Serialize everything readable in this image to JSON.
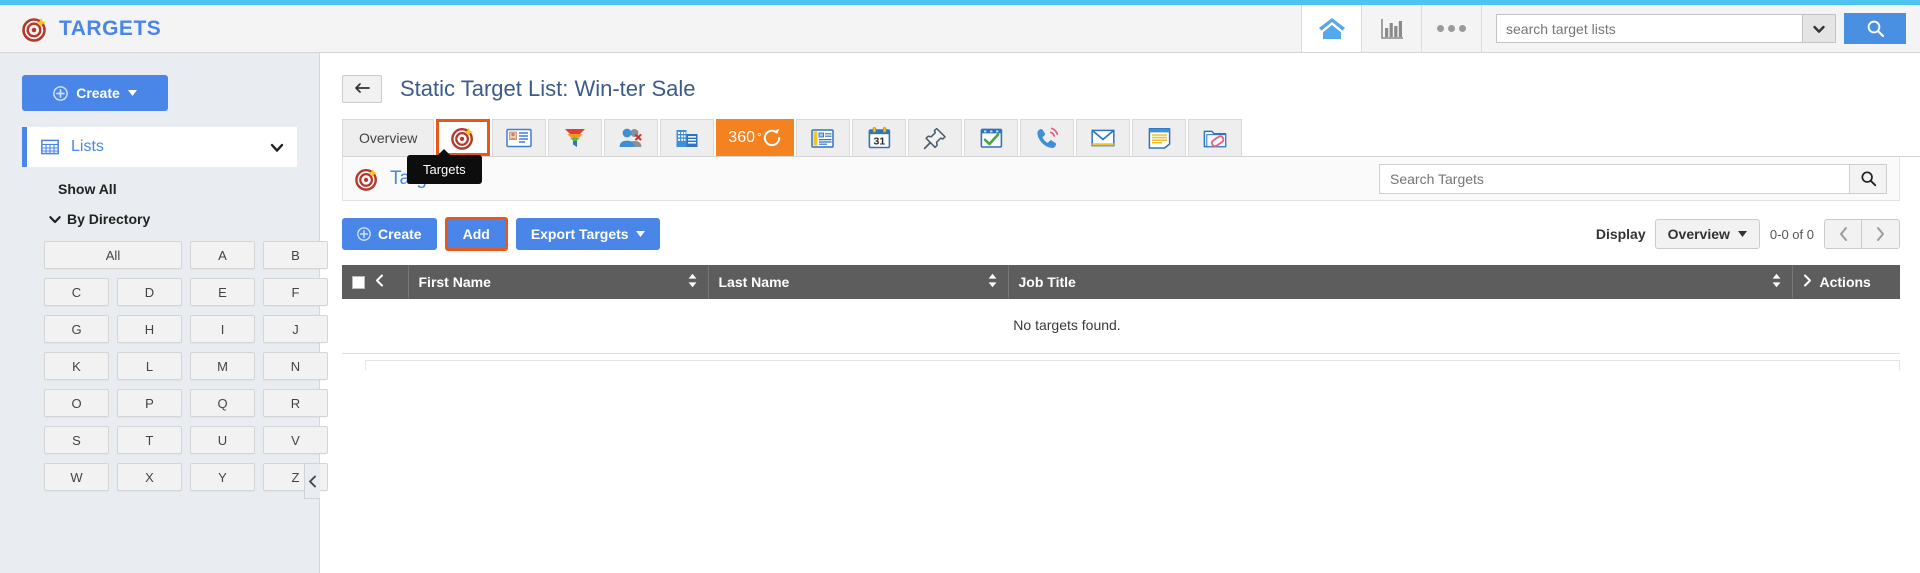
{
  "brand": {
    "name": "TARGETS",
    "logo_icon": "target-bullseye-icon",
    "accent_color": "#4a86e8",
    "topbar_accent_color": "#4ec3f0"
  },
  "topbar": {
    "home_icon": "home-icon",
    "reports_icon": "bar-chart-icon",
    "more_icon": "more-dots-icon",
    "search_placeholder": "search target lists",
    "search_value": "",
    "search_caret_icon": "chevron-down-icon",
    "search_button_icon": "search-icon"
  },
  "sidebar": {
    "create_label": "Create",
    "create_icon": "plus-circle-icon",
    "create_caret": "caret-down-icon",
    "nav": {
      "label": "Lists",
      "icon": "grid-icon",
      "caret_icon": "chevron-down-icon"
    },
    "show_all_label": "Show All",
    "by_directory_label": "By Directory",
    "by_directory_caret": "chevron-down-icon",
    "alpha_buttons": [
      "All",
      "A",
      "B",
      "C",
      "D",
      "E",
      "F",
      "G",
      "H",
      "I",
      "J",
      "K",
      "L",
      "M",
      "N",
      "O",
      "P",
      "Q",
      "R",
      "S",
      "T",
      "U",
      "V",
      "W",
      "X",
      "Y",
      "Z"
    ],
    "collapse_icon": "chevron-left-icon"
  },
  "page": {
    "back_icon": "back-arrow-icon",
    "title": "Static Target List: Win-ter Sale"
  },
  "tabs": [
    {
      "label": "Overview",
      "icon": "",
      "type": "text",
      "state": "normal",
      "name": "tab-overview"
    },
    {
      "label": "",
      "icon": "target-bullseye-icon",
      "type": "icon",
      "state": "selected",
      "name": "tab-targets"
    },
    {
      "label": "",
      "icon": "contact-card-icon",
      "type": "icon",
      "state": "normal",
      "name": "tab-contacts"
    },
    {
      "label": "",
      "icon": "funnel-icon",
      "type": "icon",
      "state": "normal",
      "name": "tab-leads"
    },
    {
      "label": "",
      "icon": "user-group-icon",
      "type": "icon",
      "state": "normal",
      "name": "tab-accounts-people"
    },
    {
      "label": "",
      "icon": "building-icon",
      "type": "icon",
      "state": "normal",
      "name": "tab-companies"
    },
    {
      "label": "360",
      "icon": "refresh-360-icon",
      "type": "orange",
      "state": "normal",
      "name": "tab-360-view"
    },
    {
      "label": "",
      "icon": "news-form-icon",
      "type": "icon",
      "state": "normal",
      "name": "tab-forms"
    },
    {
      "label": "",
      "icon": "calendar-31-icon",
      "type": "icon",
      "state": "normal",
      "name": "tab-calendar"
    },
    {
      "label": "",
      "icon": "pushpin-icon",
      "type": "icon",
      "state": "normal",
      "name": "tab-pinned"
    },
    {
      "label": "",
      "icon": "checklist-icon",
      "type": "icon",
      "state": "normal",
      "name": "tab-tasks"
    },
    {
      "label": "",
      "icon": "phone-call-icon",
      "type": "icon",
      "state": "normal",
      "name": "tab-calls"
    },
    {
      "label": "",
      "icon": "envelope-icon",
      "type": "icon",
      "state": "normal",
      "name": "tab-emails"
    },
    {
      "label": "",
      "icon": "notes-icon",
      "type": "icon",
      "state": "normal",
      "name": "tab-notes"
    },
    {
      "label": "",
      "icon": "folder-attachment-icon",
      "type": "icon",
      "state": "normal",
      "name": "tab-attachments"
    }
  ],
  "tooltip": {
    "text": "Targets"
  },
  "panel": {
    "title": "Targets",
    "icon": "target-bullseye-icon",
    "search_placeholder": "Search Targets",
    "search_value": "",
    "search_button_icon": "search-icon"
  },
  "actions": {
    "create_label": "Create",
    "create_icon": "plus-circle-icon",
    "add_label": "Add",
    "export_label": "Export Targets",
    "export_caret": "caret-down-icon",
    "highlight_color": "#e8581c"
  },
  "display": {
    "label": "Display",
    "selected": "Overview",
    "caret_icon": "caret-down-icon",
    "count": "0-0 of 0",
    "prev_icon": "chevron-left-icon",
    "next_icon": "chevron-right-icon"
  },
  "table": {
    "select_all_icon": "checkbox-icon",
    "collapse_icon": "chevron-left-icon",
    "expand_icon": "chevron-right-icon",
    "sort_icon": "sort-updown-icon",
    "columns": [
      {
        "key": "first_name",
        "label": "First Name",
        "sortable": true
      },
      {
        "key": "last_name",
        "label": "Last Name",
        "sortable": true
      },
      {
        "key": "job_title",
        "label": "Job Title",
        "sortable": true
      }
    ],
    "actions_label": "Actions",
    "rows": [],
    "empty_message": "No targets found."
  }
}
